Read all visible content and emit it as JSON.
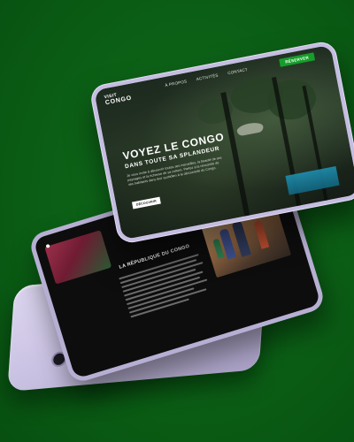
{
  "colors": {
    "background": "#0b5e15",
    "device": "#c5bde0",
    "accent_green": "#159e2a",
    "screen_dark": "#0d0d0d"
  },
  "front_screen": {
    "brand_line1": "VISIT",
    "brand_line2": "CONGO",
    "nav": [
      "À PROPOS",
      "ACTIVITÉS",
      "CONTACT"
    ],
    "cta_label": "RÉSERVER",
    "hero_title": "VOYEZ LE CONGO",
    "hero_subtitle": "DANS TOUTE SA SPLANDEUR",
    "hero_body": "Je vous invite à découvrir toutes ses merveilles, la beauté de ses paysages et la richesse de sa culture. Partez à la rencontre de ses habitants dans leur quotidien à la découverte du Congo.",
    "hero_button": "DÉCOUVRIR"
  },
  "mid_screen": {
    "section_heading": "LA RÉPUBLIQUE DU CONGO"
  },
  "icons": {
    "camera": "camera-icon",
    "device_logo": "apple-logo-icon"
  }
}
